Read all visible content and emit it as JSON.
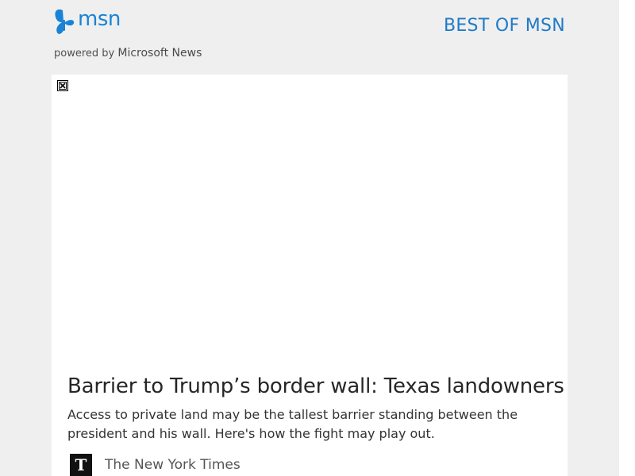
{
  "header": {
    "logo_text": "msn",
    "logo_icon": "butterfly-icon",
    "powered_prefix": "powered by",
    "powered_brand": "Microsoft News",
    "best_of_link": "BEST OF MSN"
  },
  "article": {
    "image_state": "broken-image-icon",
    "headline": "Barrier to Trump’s border wall: Texas landowners",
    "summary": "Access to private land may be the tallest barrier standing between the president and his wall. Here's how the fight may play out.",
    "source": {
      "name": "The New York Times",
      "logo_glyph": "T",
      "logo_icon": "nyt-logo-icon"
    }
  },
  "colors": {
    "accent": "#1883d7",
    "page_background": "#efefef",
    "card_background": "#ffffff",
    "headline": "#262626"
  }
}
